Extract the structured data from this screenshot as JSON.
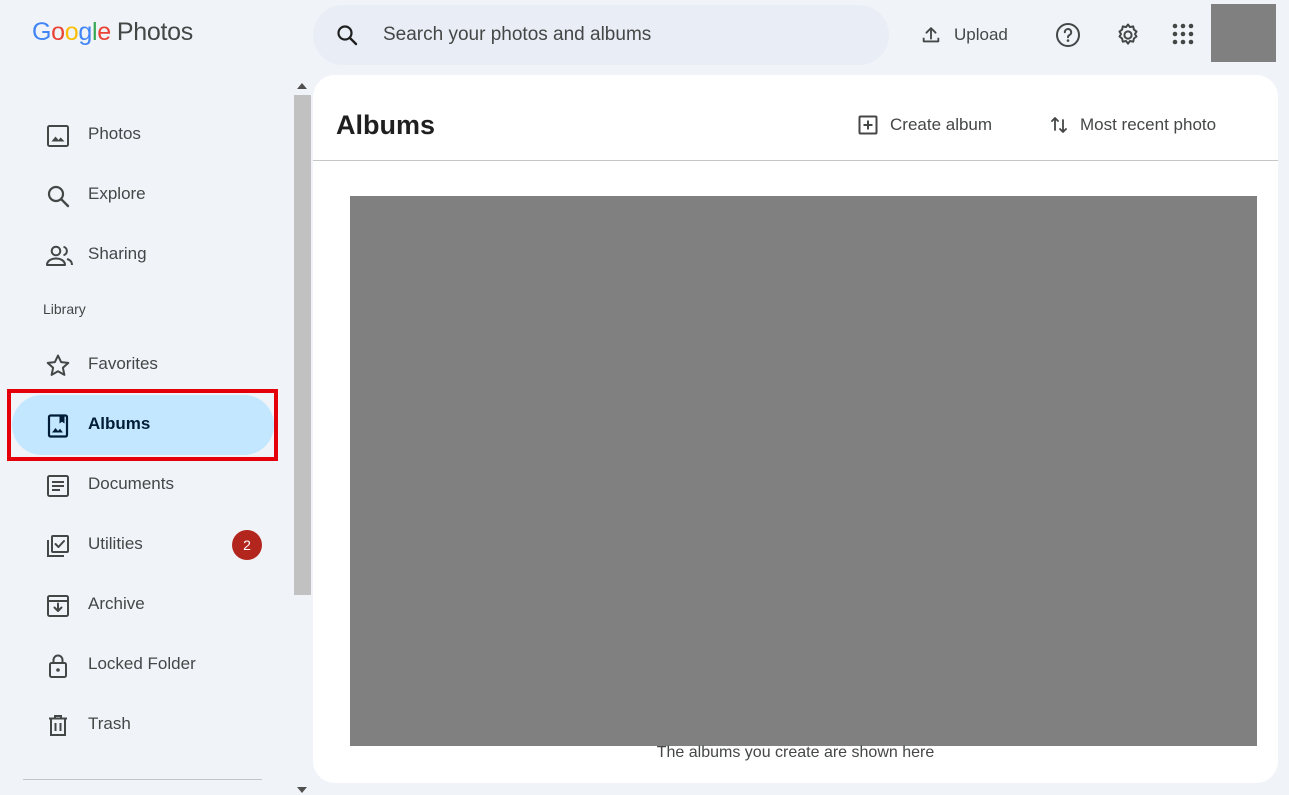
{
  "app": {
    "logo_letters": [
      "G",
      "o",
      "o",
      "g",
      "l",
      "e"
    ],
    "product_name": "Photos"
  },
  "header": {
    "search_placeholder": "Search your photos and albums",
    "upload_label": "Upload",
    "icons": [
      "search-icon",
      "upload-icon",
      "help-icon",
      "settings-icon",
      "apps-grid-icon"
    ]
  },
  "sidebar": {
    "items_top": [
      {
        "label": "Photos",
        "icon": "photo-icon"
      },
      {
        "label": "Explore",
        "icon": "search-icon"
      },
      {
        "label": "Sharing",
        "icon": "people-icon"
      }
    ],
    "section_label": "Library",
    "items_library": [
      {
        "label": "Favorites",
        "icon": "star-icon"
      },
      {
        "label": "Albums",
        "icon": "album-icon",
        "active": true
      },
      {
        "label": "Documents",
        "icon": "document-icon"
      },
      {
        "label": "Utilities",
        "icon": "utilities-icon",
        "badge": "2"
      },
      {
        "label": "Archive",
        "icon": "archive-icon"
      },
      {
        "label": "Locked Folder",
        "icon": "lock-icon"
      },
      {
        "label": "Trash",
        "icon": "trash-icon"
      }
    ]
  },
  "main": {
    "title": "Albums",
    "create_album_label": "Create album",
    "sort_label": "Most recent photo",
    "empty_text": "The albums you create are shown here"
  },
  "colors": {
    "background": "#f0f4f9",
    "active_nav": "#c2e7ff",
    "badge": "#b3261e",
    "highlight": "#e3000b"
  }
}
